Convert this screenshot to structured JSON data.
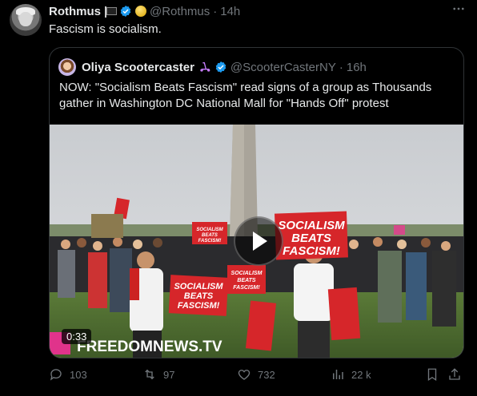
{
  "post": {
    "author_name": "Rothmus",
    "handle": "@Rothmus",
    "separator": "·",
    "time": "14h",
    "text": "Fascism is socialism."
  },
  "quote": {
    "author_name": "Oliya Scootercaster",
    "handle": "@ScooterCasterNY",
    "separator": "·",
    "time": "16h",
    "text": "NOW: \"Socialism Beats Fascism\" read signs of a group as Thousands gather in Washington DC National Mall for \"Hands Off\" protest",
    "video": {
      "duration": "0:33",
      "watermark": "FREEDOMNEWS.TV",
      "sign_text": [
        "SOCIALISM",
        "BEATS",
        "FASCISM!"
      ]
    }
  },
  "actions": {
    "replies": "103",
    "reposts": "97",
    "likes": "732",
    "views": "22 k"
  },
  "colors": {
    "background": "#000000",
    "text": "#e7e9ea",
    "muted": "#71767b",
    "verified": "#1d9bf0",
    "sign_red": "#d6262a"
  },
  "icons": [
    "more-icon",
    "verified-icon",
    "flag-icon",
    "coin-icon",
    "scooter-icon",
    "play-icon",
    "reply-icon",
    "repost-icon",
    "like-icon",
    "views-icon",
    "bookmark-icon",
    "share-icon"
  ]
}
